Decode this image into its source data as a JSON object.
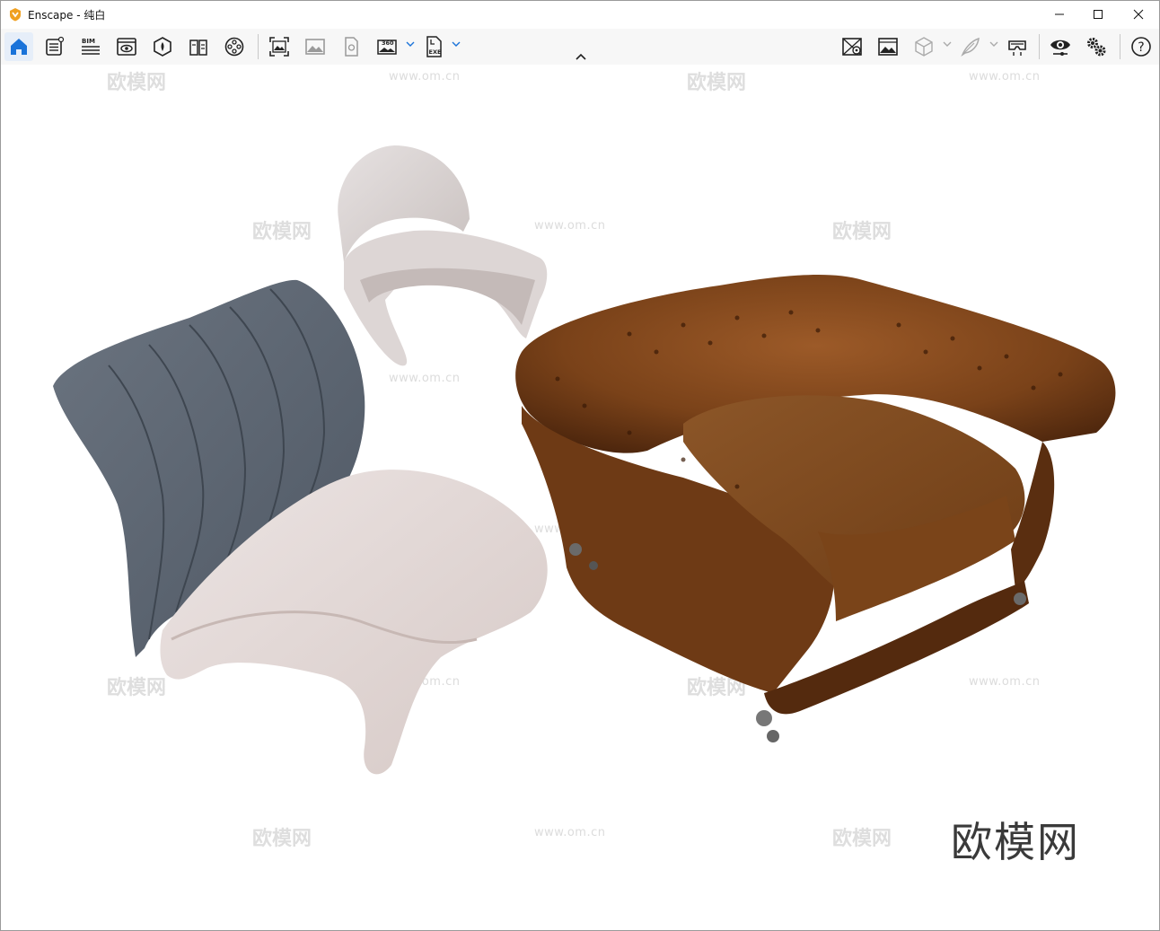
{
  "window": {
    "app_name": "Enscape",
    "title": "Enscape - 纯白",
    "controls": [
      "minimize",
      "maximize",
      "close"
    ]
  },
  "toolbar": {
    "left_icons": [
      "home-icon",
      "settings-sheet-icon",
      "bim-icon",
      "view-icon",
      "asset-library-icon",
      "material-book-icon",
      "video-reel-icon",
      "screenshot-icon",
      "batch-render-icon",
      "panorama-icon",
      "export-360-icon",
      "export-exe-icon"
    ],
    "bim_label": "BIM",
    "pano_label": "360",
    "exe_label": "EXE",
    "right_icons": [
      "map-pin-view-icon",
      "gallery-icon",
      "cube-icon",
      "feather-icon",
      "vr-headset-icon",
      "visual-settings-eye-icon",
      "general-settings-gears-icon",
      "help-icon"
    ],
    "help_label": "?"
  },
  "viewport": {
    "watermark_text": "www.om.cn",
    "watermark_cn": "欧模网",
    "brand_watermark": "欧模网",
    "accent_color": "#f0a020",
    "active_color": "#1a73d9"
  }
}
